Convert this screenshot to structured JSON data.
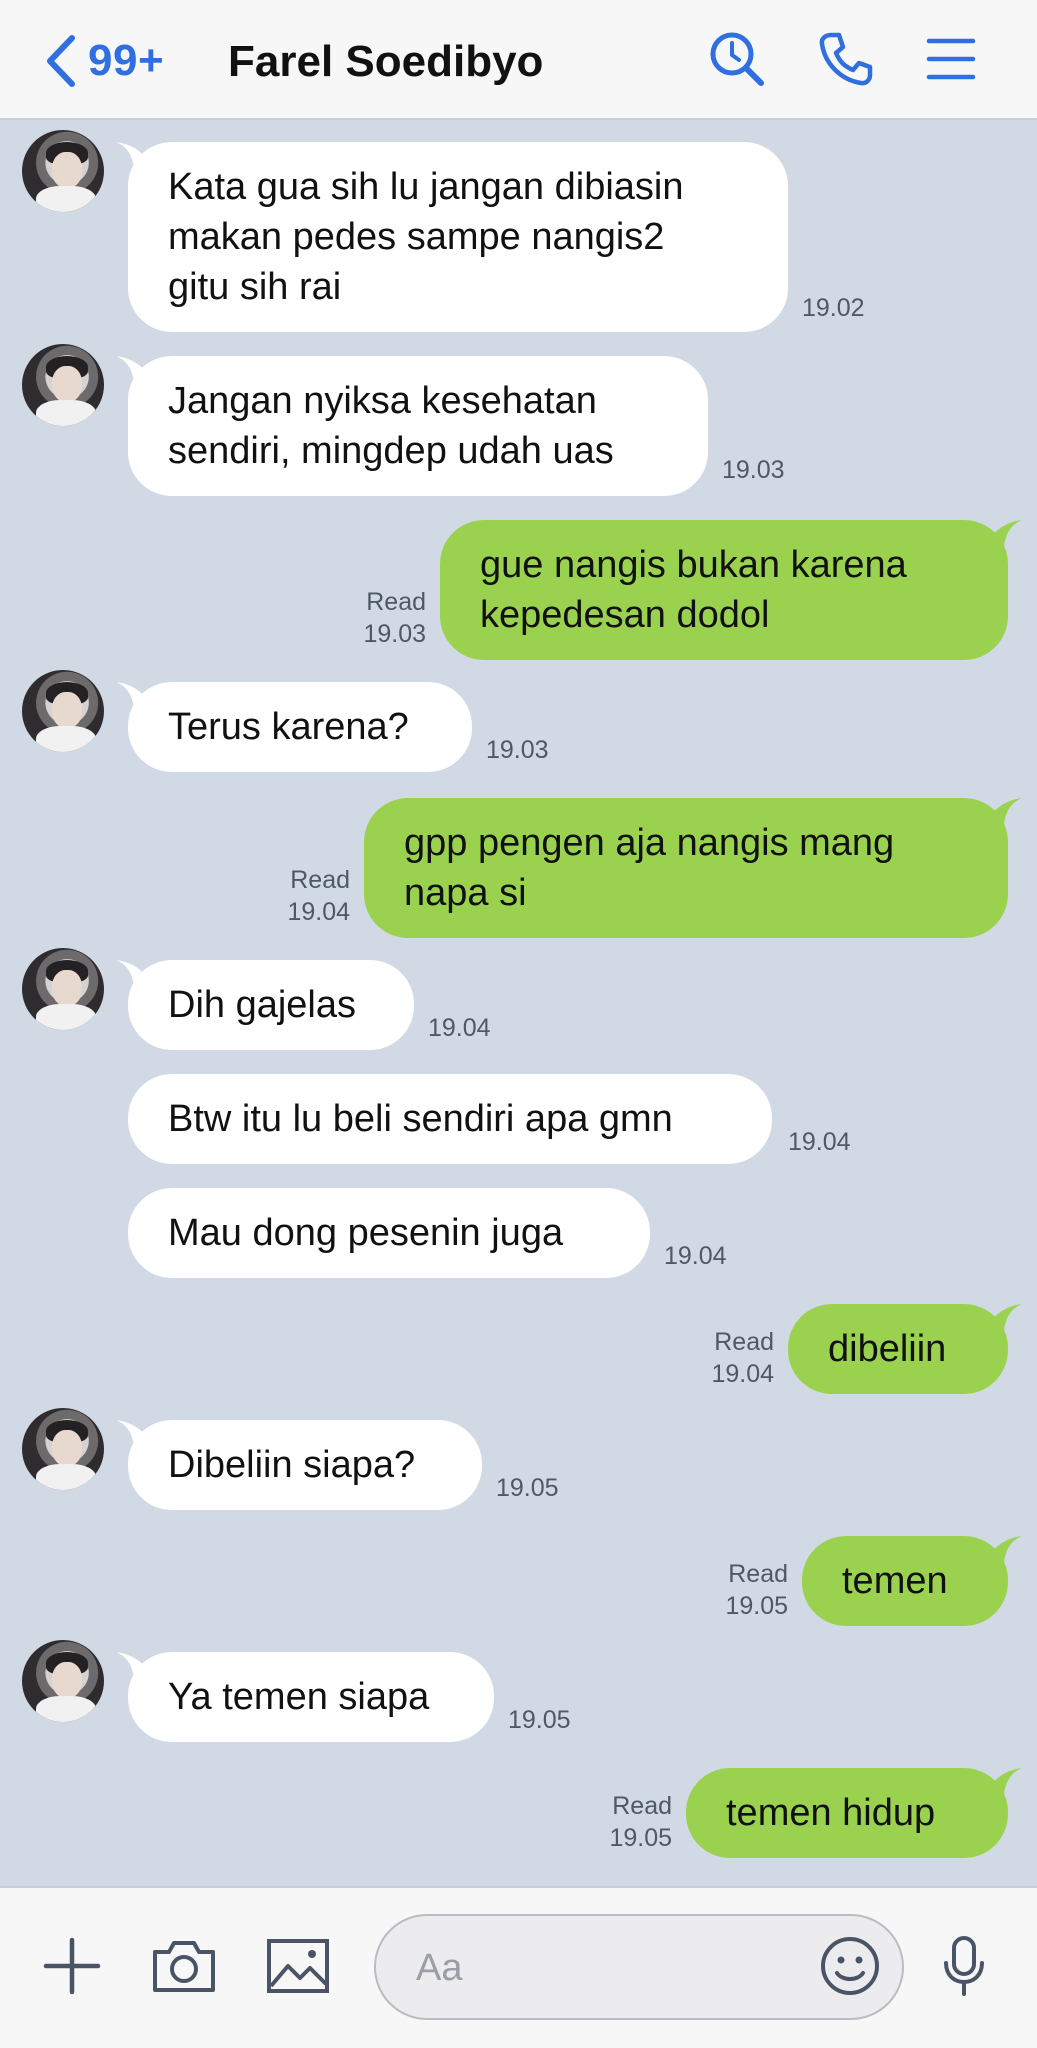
{
  "header": {
    "unread_count": "99+",
    "title": "Farel Soedibyo"
  },
  "colors": {
    "accent": "#2f6fe0",
    "background": "#d1dae4",
    "incoming_bubble": "#ffffff",
    "outgoing_bubble": "#9ad24f"
  },
  "messages": [
    {
      "direction": "in",
      "text": "Kata gua sih lu jangan dibiasin\nmakan pedes sampe nangis2\ngitu sih rai",
      "time": "19.02"
    },
    {
      "direction": "in",
      "text": "Jangan nyiksa kesehatan\nsendiri, mingdep udah uas",
      "time": "19.03"
    },
    {
      "direction": "out",
      "text": "gue nangis bukan karena\nkepedesan dodol",
      "status": "Read",
      "time": "19.03"
    },
    {
      "direction": "in",
      "text": "Terus karena?",
      "time": "19.03"
    },
    {
      "direction": "out",
      "text": "gpp pengen aja nangis mang\nnapa si",
      "status": "Read",
      "time": "19.04"
    },
    {
      "direction": "in",
      "text": "Dih gajelas",
      "time": "19.04"
    },
    {
      "direction": "in",
      "text": "Btw itu lu beli sendiri apa gmn",
      "time": "19.04"
    },
    {
      "direction": "in",
      "text": "Mau dong pesenin juga",
      "time": "19.04"
    },
    {
      "direction": "out",
      "text": "dibeliin",
      "status": "Read",
      "time": "19.04"
    },
    {
      "direction": "in",
      "text": "Dibeliin siapa?",
      "time": "19.05"
    },
    {
      "direction": "out",
      "text": "temen",
      "status": "Read",
      "time": "19.05"
    },
    {
      "direction": "in",
      "text": "Ya temen siapa",
      "time": "19.05"
    },
    {
      "direction": "out",
      "text": "temen hidup",
      "status": "Read",
      "time": "19.05"
    }
  ],
  "composer": {
    "placeholder": "Aa"
  },
  "icons": {
    "back": "chevron-left-icon",
    "search": "search-icon",
    "call": "phone-icon",
    "menu": "menu-icon",
    "plus": "plus-icon",
    "camera": "camera-icon",
    "image": "image-icon",
    "emoji": "emoji-icon",
    "mic": "microphone-icon"
  }
}
